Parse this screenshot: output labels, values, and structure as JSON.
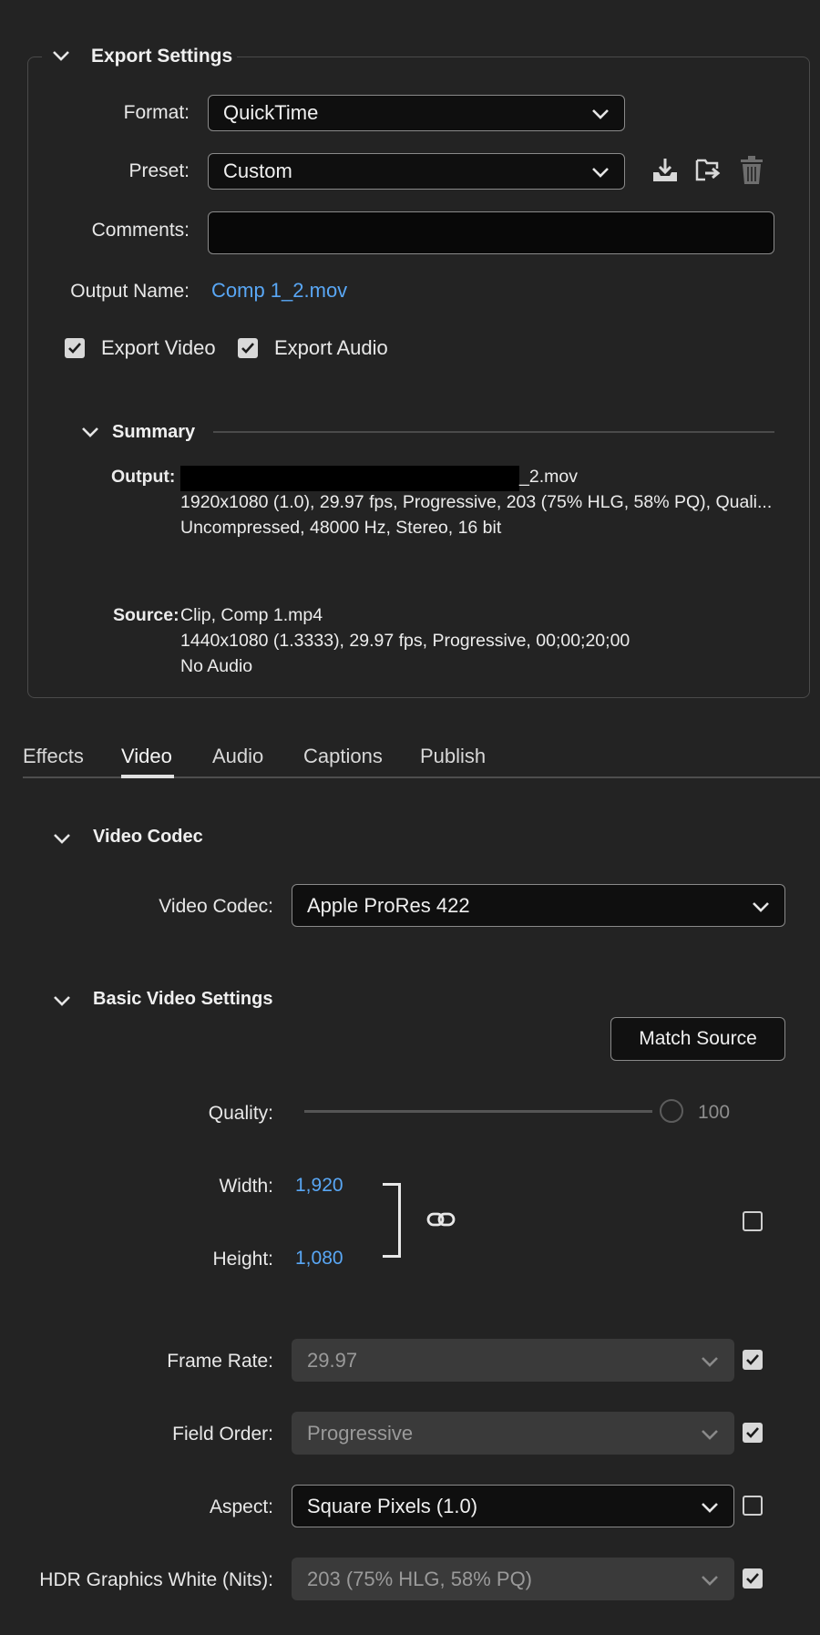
{
  "export_settings": {
    "title": "Export Settings",
    "format_label": "Format:",
    "format_value": "QuickTime",
    "preset_label": "Preset:",
    "preset_value": "Custom",
    "comments_label": "Comments:",
    "comments_value": "",
    "output_name_label": "Output Name:",
    "output_name_value": "Comp 1_2.mov",
    "export_video_label": "Export Video",
    "export_video_checked": true,
    "export_audio_label": "Export Audio",
    "export_audio_checked": true
  },
  "summary": {
    "title": "Summary",
    "output_label": "Output:",
    "output_file_suffix": "_2.mov",
    "output_video": "1920x1080 (1.0), 29.97 fps, Progressive, 203 (75% HLG, 58% PQ), Quali...",
    "output_audio": "Uncompressed, 48000 Hz, Stereo, 16 bit",
    "source_label": "Source:",
    "source_clip": "Clip, Comp 1.mp4",
    "source_video": "1440x1080 (1.3333), 29.97 fps, Progressive, 00;00;20;00",
    "source_audio": "No Audio"
  },
  "tabs": [
    {
      "label": "Effects",
      "active": false
    },
    {
      "label": "Video",
      "active": true
    },
    {
      "label": "Audio",
      "active": false
    },
    {
      "label": "Captions",
      "active": false
    },
    {
      "label": "Publish",
      "active": false
    }
  ],
  "video_codec": {
    "section_title": "Video Codec",
    "label": "Video Codec:",
    "value": "Apple ProRes 422"
  },
  "basic_video": {
    "section_title": "Basic Video Settings",
    "match_source_label": "Match Source",
    "quality_label": "Quality:",
    "quality_value": "100",
    "width_label": "Width:",
    "width_value": "1,920",
    "height_label": "Height:",
    "height_value": "1,080",
    "dimension_match_checked": false,
    "frame_rate_label": "Frame Rate:",
    "frame_rate_value": "29.97",
    "frame_rate_match": true,
    "field_order_label": "Field Order:",
    "field_order_value": "Progressive",
    "field_order_match": true,
    "aspect_label": "Aspect:",
    "aspect_value": "Square Pixels (1.0)",
    "aspect_match": false,
    "hdr_label": "HDR Graphics White (Nits):",
    "hdr_value": "203 (75% HLG, 58% PQ)",
    "hdr_match": true
  },
  "colors": {
    "background": "#232323",
    "link": "#59a7f5",
    "active_tab_underline": "#e0e0e0"
  }
}
